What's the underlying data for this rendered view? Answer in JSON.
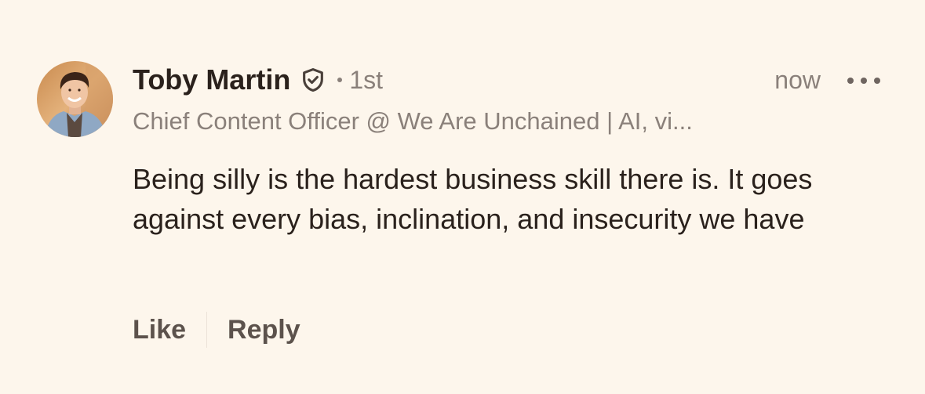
{
  "comment": {
    "author": {
      "name": "Toby Martin",
      "verified_icon": "shield-check-icon",
      "connection_degree": "1st",
      "headline": "Chief Content Officer @ We Are Unchained | AI, vi..."
    },
    "timestamp": "now",
    "more_icon": "more-horizontal-icon",
    "text": "Being silly is the hardest business skill there is. It goes against every bias, inclination, and insecurity we have",
    "actions": {
      "like_label": "Like",
      "reply_label": "Reply"
    }
  },
  "colors": {
    "background": "#fdf6ec",
    "primary_text": "#2a211c",
    "secondary_text": "#8a807a",
    "action_text": "#5c524c"
  }
}
